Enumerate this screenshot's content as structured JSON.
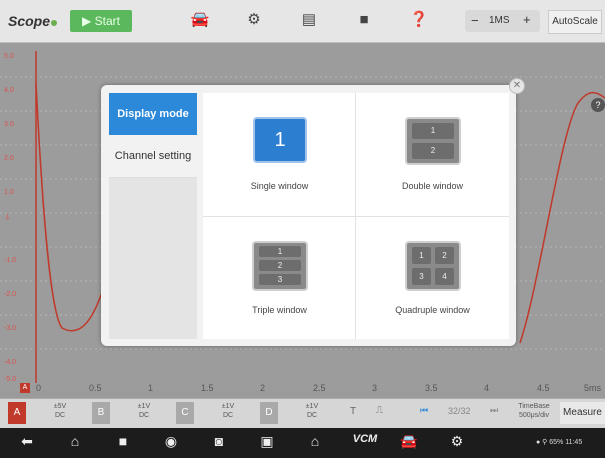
{
  "toolbar": {
    "logo": "Scope",
    "start_label": "Start",
    "timebase_value": "1MS",
    "autoscale_label": "AutoScale"
  },
  "plot": {
    "y_ticks": [
      "5.0",
      "4.0",
      "3.0",
      "2.0",
      "1.0",
      "0",
      "-1.0",
      "-2.0",
      "-3.0",
      "-4.0",
      "-5.0"
    ],
    "x_ticks": [
      "0",
      "0.5",
      "1",
      "1.5",
      "2",
      "2.5",
      "3",
      "3.5",
      "4",
      "4.5",
      "5ms"
    ],
    "ground_marker": "A",
    "trace_color": "#c0392b"
  },
  "channels": [
    {
      "name": "A",
      "volts": "±5V",
      "coupling": "DC",
      "color": "#c0392b"
    },
    {
      "name": "B",
      "volts": "±1V",
      "coupling": "DC",
      "color": "#9a9a9a"
    },
    {
      "name": "C",
      "volts": "±1V",
      "coupling": "DC",
      "color": "#9a9a9a"
    },
    {
      "name": "D",
      "volts": "±1V",
      "coupling": "DC",
      "color": "#9a9a9a"
    }
  ],
  "bottom": {
    "trigger_label": "T",
    "page": "32/32",
    "timebase_label": "TimeBase",
    "timebase_value": "500μs/div",
    "measure_label": "Measure"
  },
  "dialog": {
    "tabs": [
      "Display mode",
      "Channel setting"
    ],
    "options": [
      {
        "label": "Single window",
        "panes": [
          "1"
        ]
      },
      {
        "label": "Double window",
        "panes": [
          "1",
          "2"
        ]
      },
      {
        "label": "Triple window",
        "panes": [
          "1",
          "2",
          "3"
        ]
      },
      {
        "label": "Quadruple window",
        "panes": [
          "1",
          "2",
          "3",
          "4"
        ]
      }
    ]
  },
  "status": {
    "battery": "65%",
    "time": "11:45"
  }
}
